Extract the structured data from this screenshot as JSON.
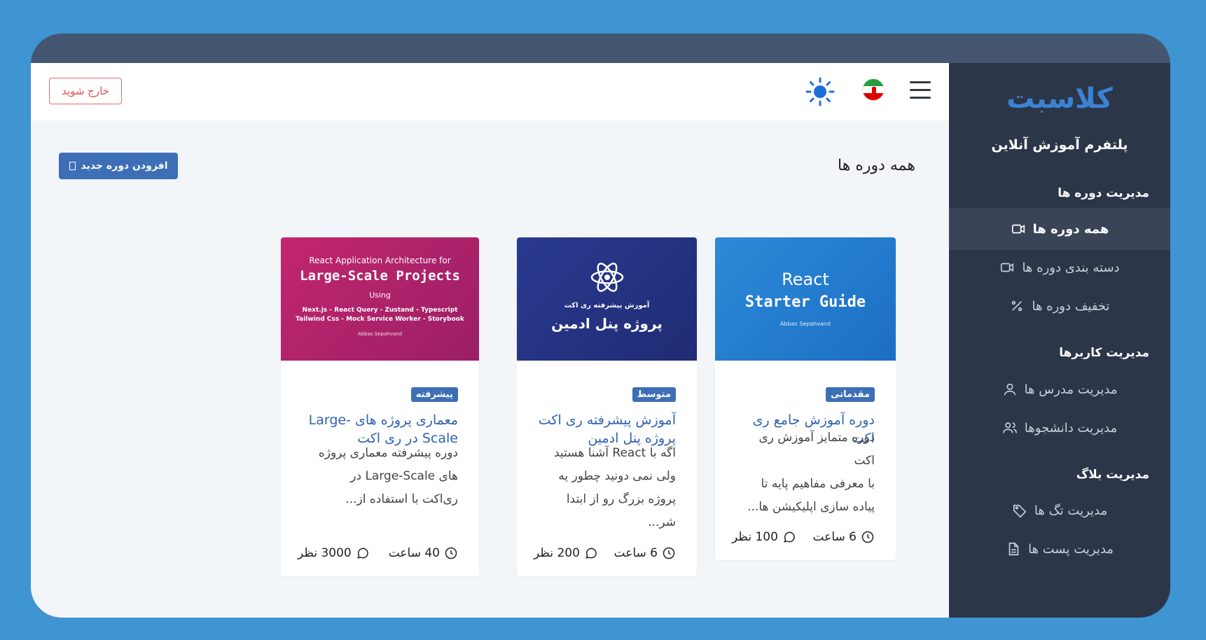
{
  "sidebar": {
    "logo": "کلاسبت",
    "platform": "پلتفرم آموزش آنلاین",
    "sections": [
      {
        "title": "مدیریت دوره ها"
      },
      {
        "title": "مدیریت کاربرها"
      },
      {
        "title": "مدیریت بلاگ"
      }
    ],
    "items": [
      {
        "label": "همه دوره ها",
        "icon": "video-icon"
      },
      {
        "label": "دسته بندی دوره ها",
        "icon": "video-icon"
      },
      {
        "label": "تخفیف دوره ها",
        "icon": "percent-icon"
      },
      {
        "label": "مدیریت مدرس ها",
        "icon": "user-icon"
      },
      {
        "label": "مدیریت دانشجوها",
        "icon": "users-icon"
      },
      {
        "label": "مدیریت تگ ها",
        "icon": "tag-icon"
      },
      {
        "label": "مدیریت پست ها",
        "icon": "file-icon"
      }
    ]
  },
  "topbar": {
    "logout_label": "خارج شوید"
  },
  "page": {
    "title": "همه دوره ها",
    "add_label": "افزودن دوره جدید"
  },
  "courses": [
    {
      "level": "مقدماتی",
      "title": "دوره آموزش جامع ری اکت",
      "desc_lines": [
        "دوره متمایز آموزش ری اکت",
        "با معرفی مفاهیم پایه تا",
        "پیاده سازی اپلیکیشن ها..."
      ],
      "duration": "6 ساعت",
      "comments": "100 نظر",
      "thumb": {
        "line1": "React",
        "line2": "Starter Guide",
        "author": "Abbas Sepahvand"
      }
    },
    {
      "level": "متوسط",
      "title": "آموزش پیشرفته ری اکت پروژه پنل ادمین",
      "desc_lines": [
        "اگه با React آشنا هستید",
        "ولی نمی دونید چطور یه",
        "پروژه بزرگ رو از ابتدا شر..."
      ],
      "duration": "6 ساعت",
      "comments": "200 نظر",
      "thumb": {
        "line1": "آموزش پیشرفته ری اکت",
        "line2": "پروژه پنل ادمین"
      }
    },
    {
      "level": "پیشرفته",
      "title": "معماری پروژه های Large-Scale در ری اکت",
      "desc_lines": [
        "دوره پیشرفته معماری پروژه",
        "های Large-Scale در",
        "ری‌اکت با استفاده از..."
      ],
      "duration": "40 ساعت",
      "comments": "3000 نظر",
      "thumb": {
        "line1": "React Application Architecture for",
        "line2": "Large-Scale Projects",
        "line3": "Using",
        "line4": "Next.js - React Query - Zustand - Typescript",
        "line5": "Tailwind Css - Mock Service Worker - Storybook",
        "author": "Abbas Sepahvand"
      }
    }
  ],
  "colors": {
    "background": "#3f94d2",
    "sidebar": "#2c3649",
    "accent": "#3d6fb6",
    "logout": "#d9534f"
  }
}
